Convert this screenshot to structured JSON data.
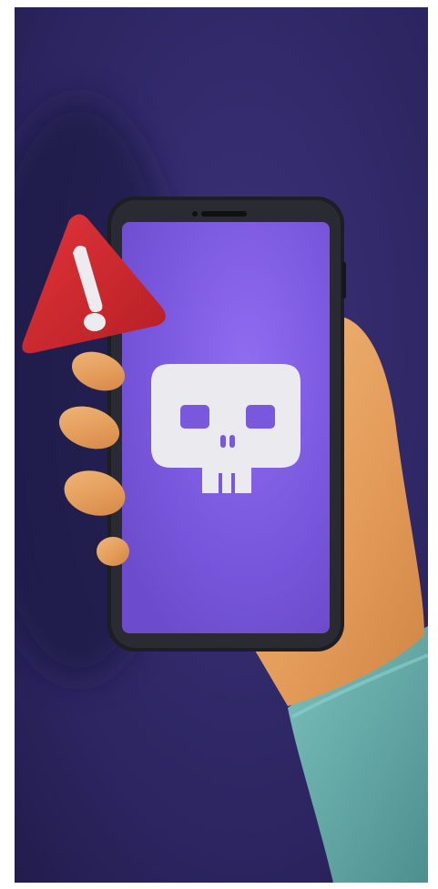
{
  "scene": {
    "background_color": "#2d2660",
    "phone_screen_color": "#7b5ce0",
    "phone_frame_color": "#1c1c22",
    "warning_color": "#d3262a",
    "skull_color": "#ececf0",
    "skin_color": "#e8a060",
    "sleeve_color": "#5fa6a5",
    "icons": [
      "warning-triangle-icon",
      "skull-icon"
    ]
  }
}
